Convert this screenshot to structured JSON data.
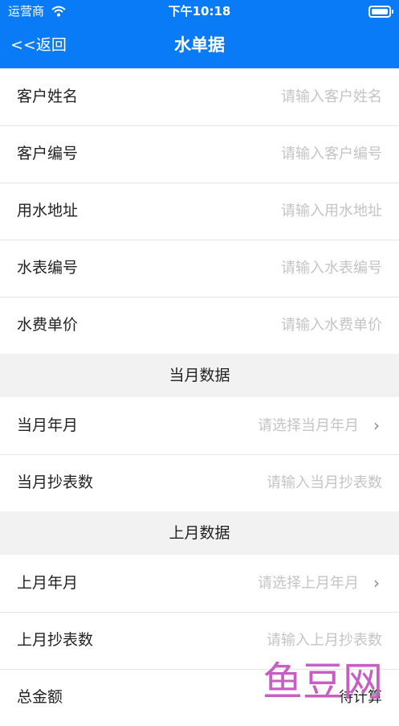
{
  "status": {
    "carrier": "运营商",
    "time": "下午10:18"
  },
  "nav": {
    "back_label": "<<返回",
    "title": "水单据"
  },
  "customer_fields": [
    {
      "label": "客户姓名",
      "placeholder": "请输入客户姓名"
    },
    {
      "label": "客户编号",
      "placeholder": "请输入客户编号"
    },
    {
      "label": "用水地址",
      "placeholder": "请输入用水地址"
    },
    {
      "label": "水表编号",
      "placeholder": "请输入水表编号"
    },
    {
      "label": "水费单价",
      "placeholder": "请输入水费单价"
    }
  ],
  "current_month": {
    "header": "当月数据",
    "fields": [
      {
        "label": "当月年月",
        "placeholder": "请选择当月年月"
      },
      {
        "label": "当月抄表数",
        "placeholder": "请输入当月抄表数"
      }
    ]
  },
  "last_month": {
    "header": "上月数据",
    "fields": [
      {
        "label": "上月年月",
        "placeholder": "请选择上月年月"
      },
      {
        "label": "上月抄表数",
        "placeholder": "请输入上月抄表数"
      }
    ]
  },
  "total": {
    "label": "总金额",
    "value": "待计算"
  },
  "watermark": {
    "text": "鱼豆网"
  },
  "colors": {
    "nav_bg": "#0a7bf6",
    "placeholder": "#c4c4c4",
    "watermark": "#c85ec4"
  },
  "icons": {
    "wifi": "wifi-icon",
    "battery": "battery-icon",
    "chevron": "chevron-right-icon"
  }
}
